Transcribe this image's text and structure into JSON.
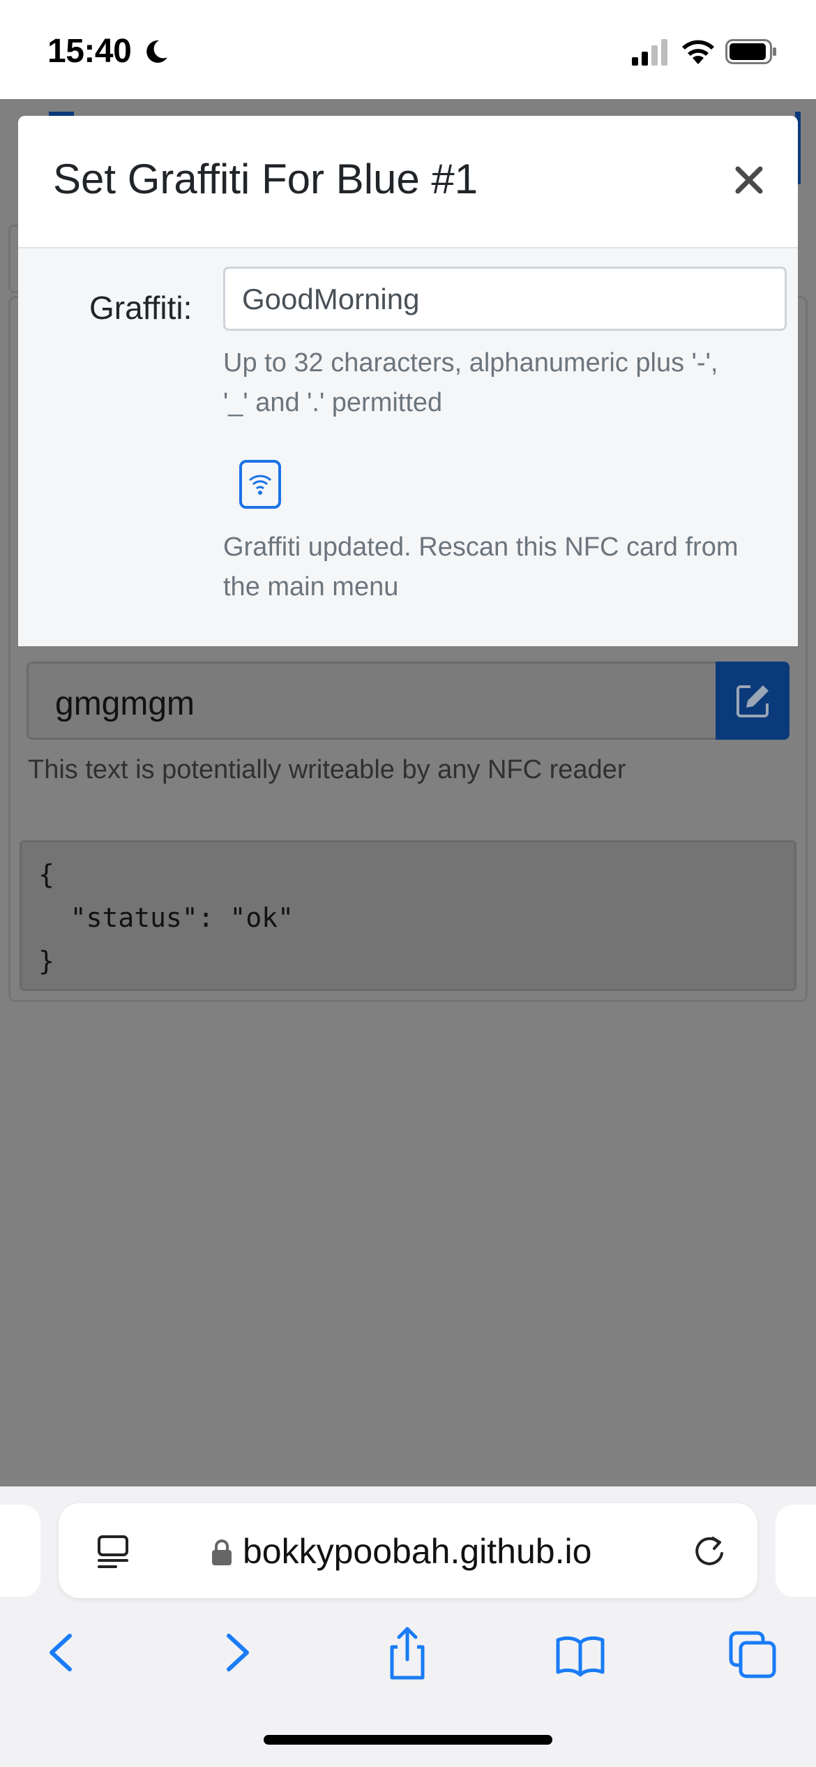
{
  "status_bar": {
    "time": "15:40"
  },
  "modal": {
    "title": "Set Graffiti For Blue #1",
    "field_label": "Graffiti:",
    "input_value": "GoodMorning",
    "help_line1": "Up to 32 characters, alphanumeric plus '-',",
    "help_line2": "'_' and '.' permitted",
    "update_line1": "Graffiti updated. Rescan this NFC card from",
    "update_line2": "the main menu"
  },
  "background": {
    "graffiti_value": "gmgmgm",
    "nfc_note": "This text is potentially writeable by any NFC reader",
    "json_lines": [
      "{",
      "  \"status\": \"ok\"",
      "}"
    ]
  },
  "browser": {
    "url": "bokkypoobah.github.io"
  },
  "colors": {
    "accent": "#1a73e8",
    "safari_blue": "#1a7cf6"
  }
}
